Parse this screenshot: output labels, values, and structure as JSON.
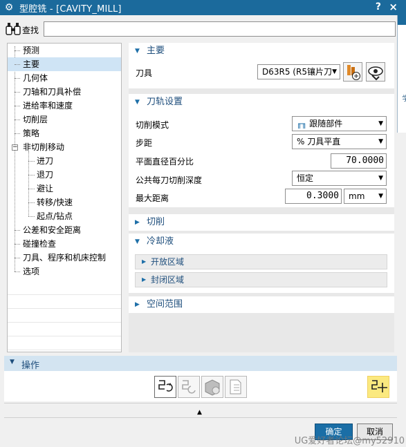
{
  "window": {
    "title": "型腔铣 - [CAVITY_MILL]",
    "help": "?",
    "close": "×"
  },
  "search": {
    "label": "查找",
    "value": ""
  },
  "tree": {
    "items": [
      {
        "label": "预测"
      },
      {
        "label": "主要"
      },
      {
        "label": "几何体"
      },
      {
        "label": "刀轴和刀具补偿"
      },
      {
        "label": "进给率和速度"
      },
      {
        "label": "切削层"
      },
      {
        "label": "策略"
      },
      {
        "label": "非切削移动"
      },
      {
        "label": "进刀"
      },
      {
        "label": "退刀"
      },
      {
        "label": "避让"
      },
      {
        "label": "转移/快速"
      },
      {
        "label": "起点/钻点"
      },
      {
        "label": "公差和安全距离"
      },
      {
        "label": "碰撞检查"
      },
      {
        "label": "刀具、程序和机床控制"
      },
      {
        "label": "选项"
      }
    ],
    "expander": "−"
  },
  "main": {
    "title": "主要",
    "tool_label": "刀具",
    "tool_value": "D63R5 (R5镶片刀"
  },
  "path": {
    "title": "刀轨设置",
    "cut_mode_label": "切削模式",
    "cut_mode_value": "跟随部件",
    "stepover_label": "步距",
    "stepover_value": "% 刀具平直",
    "percent_label": "平面直径百分比",
    "percent_value": "70.0000",
    "depth_label": "公共每刀切削深度",
    "depth_value": "恒定",
    "maxdist_label": "最大距离",
    "maxdist_value": "0.3000",
    "maxdist_unit": "mm"
  },
  "cutting": {
    "title": "切削"
  },
  "coolant": {
    "title": "冷却液",
    "open_label": "开放区域",
    "closed_label": "封闭区域"
  },
  "spatial": {
    "title": "空间范围"
  },
  "ops": {
    "title": "操作"
  },
  "buttons": {
    "ok": "确定",
    "cancel": "取消"
  },
  "behind_text": "学",
  "watermark": "UG爱好者论坛@my52910",
  "colors": {
    "accent": "#1b6a9c",
    "header_text": "#1e4e7c",
    "selection": "#cfe4f5",
    "highlight": "#fbe97f"
  }
}
